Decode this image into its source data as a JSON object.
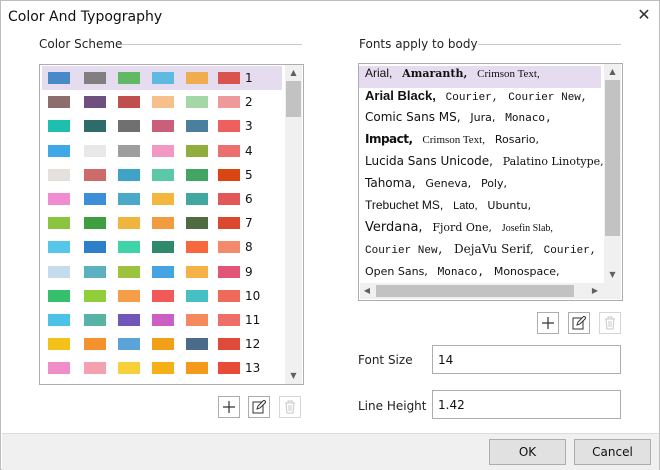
{
  "window": {
    "title": "Color And Typography",
    "close_glyph": "✕"
  },
  "color_scheme": {
    "label": "Color Scheme",
    "selected_index": 0,
    "rows": [
      {
        "number": "1",
        "colors": [
          "#4a89c8",
          "#808080",
          "#61b865",
          "#5fb9e0",
          "#f0ad4e",
          "#d9534f"
        ]
      },
      {
        "number": "2",
        "colors": [
          "#8d6e6e",
          "#6e4f7e",
          "#c0504d",
          "#f7c08a",
          "#a5d6a7",
          "#ee9a9a"
        ]
      },
      {
        "number": "3",
        "colors": [
          "#1fbfb0",
          "#2e6b6b",
          "#707070",
          "#c95f7a",
          "#4a7f9f",
          "#ee6060"
        ]
      },
      {
        "number": "4",
        "colors": [
          "#3fa9e8",
          "#e8e8e8",
          "#9e9e9e",
          "#f199c3",
          "#8fae3e",
          "#ec7070"
        ]
      },
      {
        "number": "5",
        "colors": [
          "#e6e0dc",
          "#cd6b6b",
          "#3fa3c7",
          "#5bc8a7",
          "#43a564",
          "#d94612"
        ]
      },
      {
        "number": "6",
        "colors": [
          "#f08ccf",
          "#3d8ed9",
          "#4aa9c9",
          "#f3b63f",
          "#40a8a0",
          "#e25757"
        ]
      },
      {
        "number": "7",
        "colors": [
          "#8bc43f",
          "#3f9e3f",
          "#f0b53f",
          "#f39c3f",
          "#4f6b3f",
          "#d9482f"
        ]
      },
      {
        "number": "8",
        "colors": [
          "#56c7e9",
          "#2e7fc9",
          "#3fd3a7",
          "#2f8a6b",
          "#f7683e",
          "#f28a6b"
        ]
      },
      {
        "number": "9",
        "colors": [
          "#c6dcec",
          "#5cb0c0",
          "#9bc33d",
          "#44a4e4",
          "#f5b347",
          "#e05578"
        ]
      },
      {
        "number": "10",
        "colors": [
          "#35c06e",
          "#91ce3a",
          "#f59d48",
          "#f25a5a",
          "#45c1c5",
          "#ef6a5a"
        ]
      },
      {
        "number": "11",
        "colors": [
          "#4bc2e6",
          "#57b3a3",
          "#7157b8",
          "#cc5fc4",
          "#f58a5e",
          "#f06e68"
        ]
      },
      {
        "number": "12",
        "colors": [
          "#f2c11a",
          "#f4922e",
          "#5ba3d9",
          "#f2a01a",
          "#4a6b8a",
          "#e04a3a"
        ]
      },
      {
        "number": "13",
        "colors": [
          "#f08ec8",
          "#f3a0b0",
          "#f7cf3a",
          "#f5b018",
          "#f39a1a",
          "#e84a3a"
        ]
      }
    ],
    "row_14_partial": [
      "#8fd06e",
      "#e6e6e6",
      "#a6e0a6",
      "#f0c0e0",
      "#e8b0c0",
      "#e0a0c0"
    ]
  },
  "fonts": {
    "label": "Fonts apply to body",
    "selected_line": 0,
    "lines": [
      "Arial, Amaranth, Crimson Text,",
      "Arial Black, Courier, Courier New,",
      "Comic Sans MS, Jura, Monaco,",
      "Impact, Crimson Text, Rosario,",
      "Lucida Sans Unicode, Palatino Linotype, C",
      "Tahoma, Geneva, Poly,",
      "Trebuchet MS, Lato, Ubuntu,",
      "Verdana, Fjord One, Josefin Slab,",
      "Courier New, DejaVu Serif, Courier,",
      "Open Sans, Monaco, Monospace,"
    ]
  },
  "fields": {
    "font_size": {
      "label": "Font Size",
      "value": "14"
    },
    "line_height": {
      "label": "Line Height",
      "value": "1.42"
    }
  },
  "buttons": {
    "ok": "OK",
    "cancel": "Cancel"
  },
  "icons": {
    "add": "plus-icon",
    "edit": "edit-icon",
    "delete": "trash-icon"
  }
}
